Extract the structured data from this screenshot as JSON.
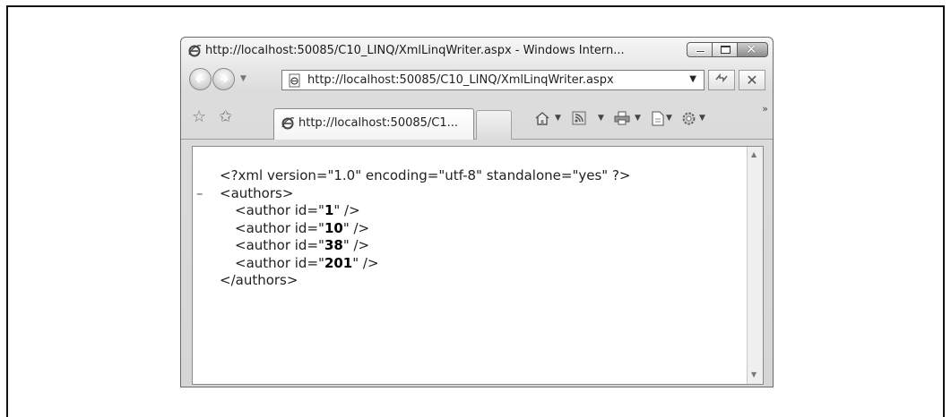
{
  "window": {
    "title": "http://localhost:50085/C10_LINQ/XmlLinqWriter.aspx - Windows Intern...",
    "close_glyph": "✕"
  },
  "nav": {
    "address": "http://localhost:50085/C10_LINQ/XmlLinqWriter.aspx",
    "dropdown_arrow": "▼",
    "refresh_glyph": "⁴⁄",
    "stop_glyph": "✕"
  },
  "tabs": {
    "active_label": "http://localhost:50085/C1...",
    "more_glyph": "»"
  },
  "toolbar": {
    "caret": "▼"
  },
  "icons": {
    "favorites": "star-icon",
    "add_favorites": "add-favorites-icon",
    "home": "home-icon",
    "feeds": "feeds-icon",
    "print": "print-icon",
    "page": "page-icon",
    "tools": "tools-icon"
  },
  "xml_doc": {
    "declaration": "<?xml version=\"1.0\" encoding=\"utf-8\" standalone=\"yes\" ?>",
    "collapse_marker": "–",
    "root_open": "<authors>",
    "author_prefix": "<author id=\"",
    "author_suffix": "\" />",
    "authors": [
      "1",
      "10",
      "38",
      "201"
    ],
    "root_close": "</authors>"
  }
}
